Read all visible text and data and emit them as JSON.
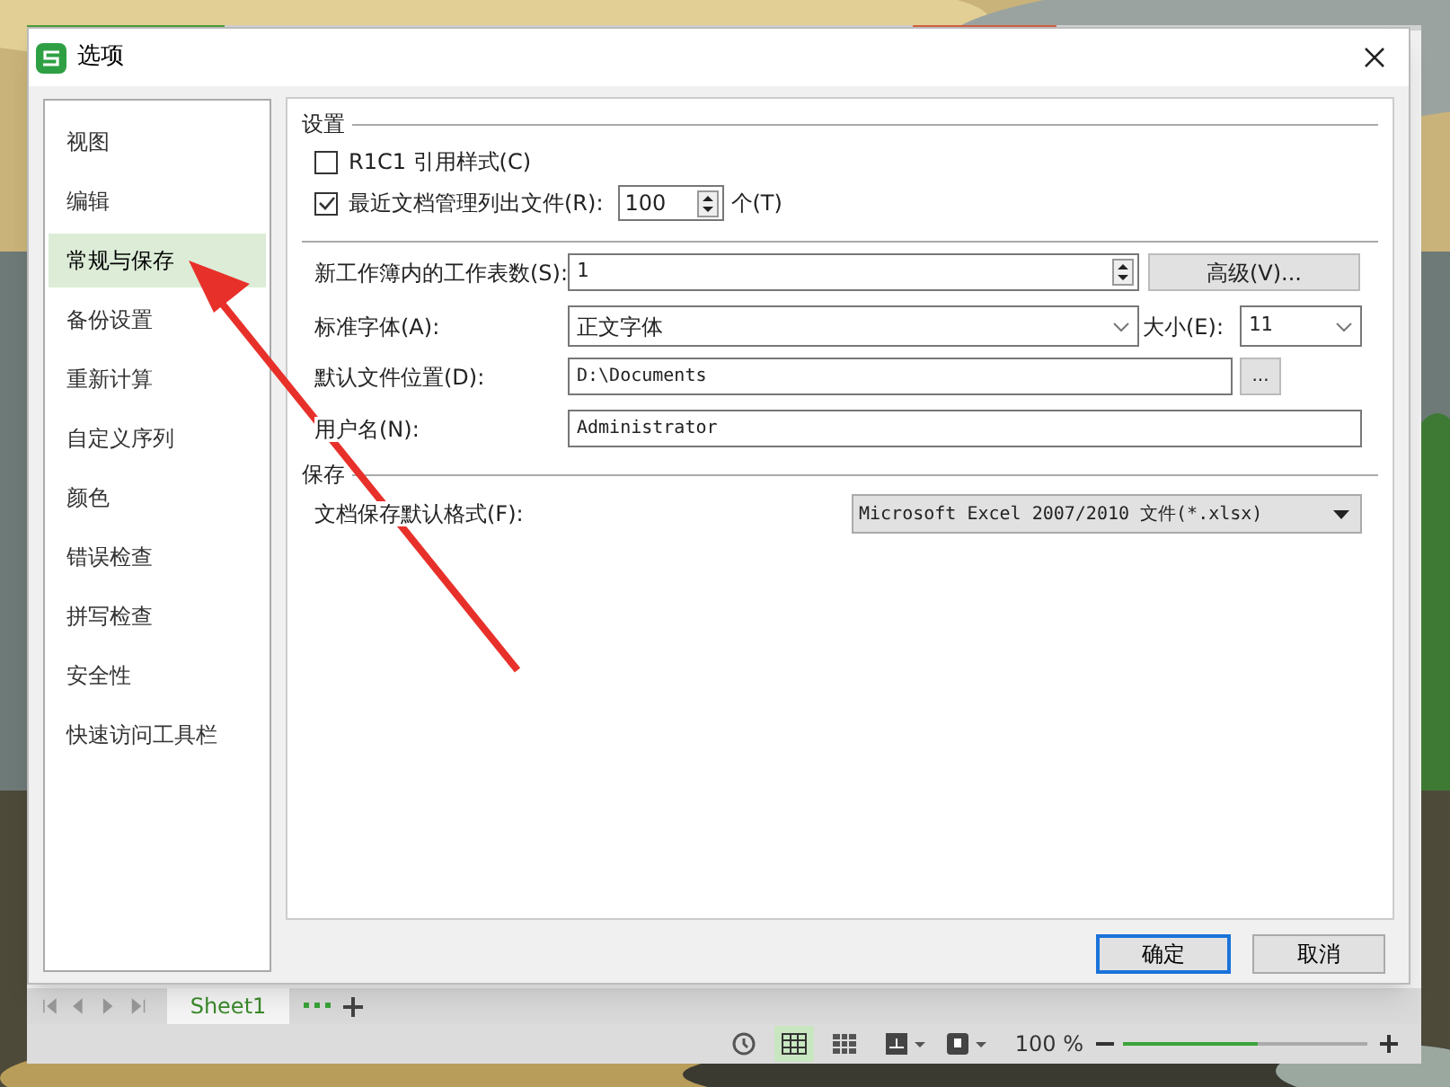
{
  "dialog": {
    "title": "选项",
    "ok": "确定",
    "cancel": "取消"
  },
  "sidebar": {
    "items": [
      {
        "label": "视图",
        "selected": false
      },
      {
        "label": "编辑",
        "selected": false
      },
      {
        "label": "常规与保存",
        "selected": true
      },
      {
        "label": "备份设置",
        "selected": false
      },
      {
        "label": "重新计算",
        "selected": false
      },
      {
        "label": "自定义序列",
        "selected": false
      },
      {
        "label": "颜色",
        "selected": false
      },
      {
        "label": "错误检查",
        "selected": false
      },
      {
        "label": "拼写检查",
        "selected": false
      },
      {
        "label": "安全性",
        "selected": false
      },
      {
        "label": "快速访问工具栏",
        "selected": false
      }
    ]
  },
  "settings": {
    "heading": "设置",
    "r1c1": {
      "label": "R1C1 引用样式(C)",
      "checked": false
    },
    "recent": {
      "label": "最近文档管理列出文件(R):",
      "checked": true,
      "value": "100",
      "unit": "个(T)"
    },
    "sheets": {
      "label": "新工作簿内的工作表数(S):",
      "value": "1",
      "button": "高级(V)..."
    },
    "font": {
      "label": "标准字体(A):",
      "value": "正文字体",
      "size_label": "大小(E):",
      "size": "11"
    },
    "location": {
      "label": "默认文件位置(D):",
      "value": "D:\\Documents",
      "browse": "..."
    },
    "user": {
      "label": "用户名(N):",
      "value": "Administrator"
    }
  },
  "save": {
    "heading": "保存",
    "format": {
      "label": "文档保存默认格式(F):",
      "value": "Microsoft Excel 2007/2010 文件(*.xlsx)"
    }
  },
  "sheet_tabs": [
    {
      "label": "Sheet1",
      "selected": true
    }
  ],
  "status_bar": {
    "zoom": "100 %",
    "zoom_slider": {
      "level": 0.55
    }
  }
}
